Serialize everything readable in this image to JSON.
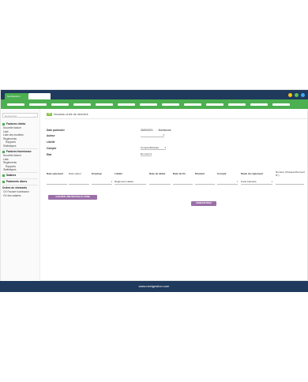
{
  "app": {
    "tab_label": "NextGestion"
  },
  "colors": {
    "titlebar": "#1f3a5c",
    "menubar": "#4caf50",
    "accent_button": "#9b6fa8",
    "dot_yellow": "#f5c518",
    "dot_green": "#5cc25c",
    "dot_blue": "#3fa9f5"
  },
  "sidebar": {
    "search_placeholder": "Rechercher",
    "sections": [
      {
        "title": "Factures clients",
        "icon": "square-icon",
        "items": [
          "Nouvelle facture",
          "Liste",
          "Liste des modèles",
          "Règlements",
          "Rapports",
          "Statistiques"
        ]
      },
      {
        "title": "Factures fournisseur",
        "icon": "square-icon",
        "items": [
          "Nouvelle facture",
          "Liste",
          "Règlements",
          "Rapports",
          "Statistiques"
        ]
      },
      {
        "title": "Salaires",
        "icon": "square-icon",
        "items": []
      },
      {
        "title": "Paiements divers",
        "icon": "square-icon",
        "items": []
      },
      {
        "title": "Ordres de virements",
        "icon": "",
        "items": [
          "OV Facture fournisseur",
          "OV des salaires"
        ]
      }
    ]
  },
  "page": {
    "title": "Nouveau ordre de virement",
    "title_badge": "OV",
    "form": {
      "date_label": "Date paiement",
      "date_value": "30/06/2021",
      "date_link": "Maintenant",
      "author_label": "Auteur",
      "author_value": "",
      "libelle_label": "Libellé",
      "compte_label": "Compte",
      "compte_value": "Compte Bancaire",
      "etat_label": "Etat",
      "etat_value": "En cours"
    },
    "table": {
      "headers": [
        "Date paiement",
        "Date valeur",
        "Employé",
        "Libellé",
        "Date de début",
        "Date de fin",
        "Montant",
        "Compte",
        "Mode de règlement",
        "Numéro (Chèque/Virement N°)"
      ],
      "row": {
        "libelle": "Règlement salaire",
        "mode": "Carte bancaire"
      }
    },
    "add_line_button": "AJOUTER UNE NOUVELLE LIGNE",
    "save_button": "ENREGISTRER"
  },
  "footer": {
    "site": "www.nextgestion.com"
  }
}
